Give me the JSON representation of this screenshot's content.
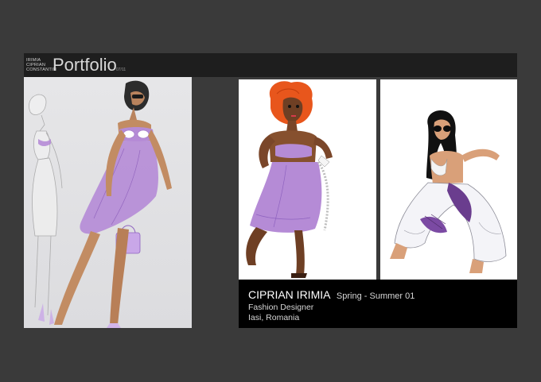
{
  "header": {
    "names": [
      "IRIMIA",
      "CIPRIAN",
      "CONSTANTIN"
    ],
    "title": "Portfolio",
    "page_indicator": "07/11"
  },
  "gallery": {
    "images": [
      {
        "id": "left",
        "icon": "fashion-sketch-two-figures"
      },
      {
        "id": "middle",
        "icon": "fashion-sketch-red-hair-lilac-dress"
      },
      {
        "id": "right",
        "icon": "fashion-sketch-crouching-figure"
      }
    ]
  },
  "caption": {
    "name": "CIPRIAN IRIMIA",
    "season": "Spring - Summer 01",
    "role": "Fashion Designer",
    "location": "Iasi, Romania"
  },
  "colors": {
    "background": "#3a3a3a",
    "header_bar": "#1e1e1e",
    "caption_bg": "#000000",
    "accent_lilac": "#b38ad6",
    "hair_orange": "#e8561c"
  }
}
